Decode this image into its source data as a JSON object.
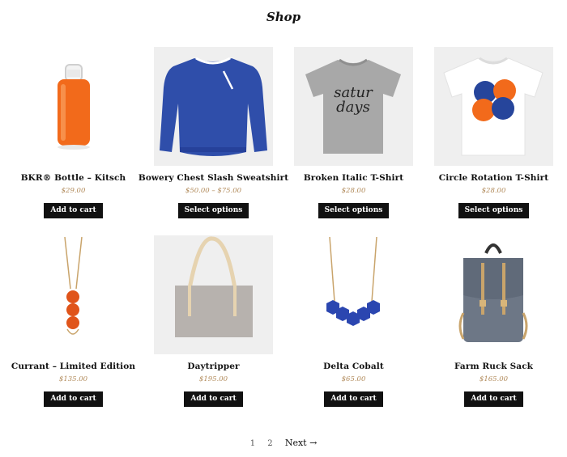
{
  "page": {
    "title": "Shop"
  },
  "products": [
    {
      "name": "BKR® Bottle – Kitsch",
      "price": "$29.00",
      "button": "Add to cart",
      "image_icon": "orange-bottle-icon"
    },
    {
      "name": "Bowery Chest Slash Sweatshirt",
      "price": "$50.00 – $75.00",
      "button": "Select options",
      "image_icon": "blue-sweatshirt-icon"
    },
    {
      "name": "Broken Italic T-Shirt",
      "price": "$28.00",
      "button": "Select options",
      "image_icon": "grey-tshirt-icon",
      "print_text_1": "satur",
      "print_text_2": "days"
    },
    {
      "name": "Circle Rotation T-Shirt",
      "price": "$28.00",
      "button": "Select options",
      "image_icon": "white-tshirt-icon"
    },
    {
      "name": "Currant – Limited Edition",
      "price": "$135.00",
      "button": "Add to cart",
      "image_icon": "orange-necklace-icon"
    },
    {
      "name": "Daytripper",
      "price": "$195.00",
      "button": "Add to cart",
      "image_icon": "tote-bag-icon"
    },
    {
      "name": "Delta Cobalt",
      "price": "$65.00",
      "button": "Add to cart",
      "image_icon": "blue-necklace-icon"
    },
    {
      "name": "Farm Ruck Sack",
      "price": "$165.00",
      "button": "Add to cart",
      "image_icon": "backpack-icon"
    }
  ],
  "pagination": {
    "page1": "1",
    "page2": "2",
    "next": "Next →"
  },
  "colors": {
    "accent_price": "#b18a5a",
    "button_bg": "#111111",
    "orange": "#f26a1b",
    "navy": "#26459b"
  }
}
